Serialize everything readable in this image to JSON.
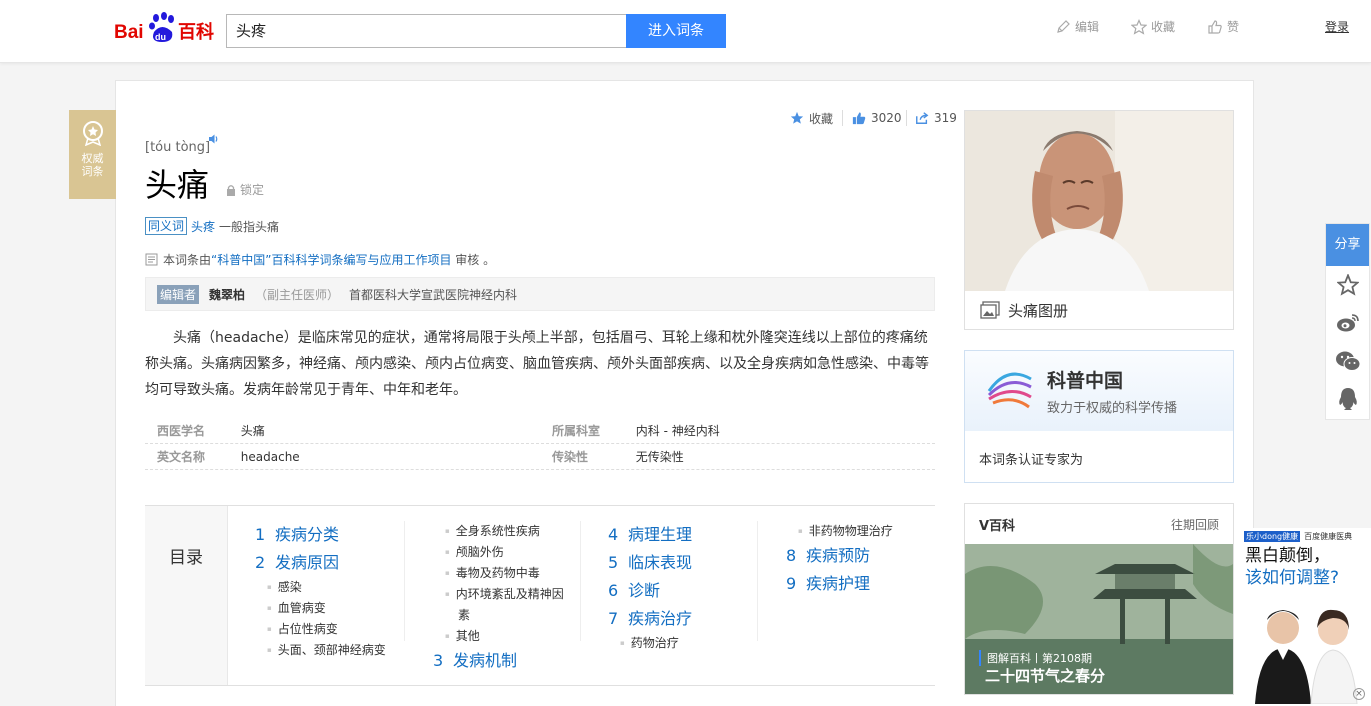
{
  "header": {
    "logo_text_left": "Bai",
    "logo_text_du": "du",
    "logo_text_right": "百科",
    "search_value": "头疼",
    "search_button": "进入词条",
    "edit_label": "编辑",
    "collect_label": "收藏",
    "like_label": "赞",
    "login_label": "登录"
  },
  "badge": {
    "line1": "权威",
    "line2": "词条"
  },
  "stats": {
    "collect_label": "收藏",
    "like_count": "3020",
    "share_count": "319"
  },
  "entry": {
    "pinyin": "[tóu tòng]",
    "title": "头痛",
    "lock_label": "锁定",
    "synonym_tag": "同义词",
    "synonym_link": "头疼",
    "synonym_text": "一般指头痛",
    "review_prefix": "本词条由",
    "review_link": "“科普中国”百科科学词条编写与应用工作项目",
    "review_suffix": "审核 。",
    "editor_tag": "编辑者",
    "editor_name": "魏翠柏",
    "editor_role": "（副主任医师）",
    "editor_hospital": "首都医科大学宣武医院神经内科",
    "summary": "头痛（headache）是临床常见的症状，通常将局限于头颅上半部，包括眉弓、耳轮上缘和枕外隆突连线以上部位的疼痛统称头痛。头痛病因繁多，神经痛、颅内感染、颅内占位病变、脑血管疾病、颅外头面部疾病、以及全身疾病如急性感染、中毒等均可导致头痛。发病年龄常见于青年、中年和老年。"
  },
  "basic_info": [
    {
      "k1": "西医学名",
      "v1": "头痛",
      "k2": "所属科室",
      "v2": "内科 - 神经内科"
    },
    {
      "k1": "英文名称",
      "v1": "headache",
      "k2": "传染性",
      "v2": "无传染性"
    }
  ],
  "catalog": {
    "title": "目录",
    "col1": [
      {
        "type": "l1",
        "num": "1",
        "text": "疾病分类"
      },
      {
        "type": "l1",
        "num": "2",
        "text": "发病原因"
      },
      {
        "type": "l2",
        "text": "感染"
      },
      {
        "type": "l2",
        "text": "血管病变"
      },
      {
        "type": "l2",
        "text": "占位性病变"
      },
      {
        "type": "l2",
        "text": "头面、颈部神经病变"
      }
    ],
    "col2": [
      {
        "type": "l2",
        "text": "全身系统性疾病"
      },
      {
        "type": "l2",
        "text": "颅脑外伤"
      },
      {
        "type": "l2",
        "text": "毒物及药物中毒"
      },
      {
        "type": "l2",
        "text": "内环境紊乱及精神因"
      },
      {
        "type": "l2c",
        "text": "素"
      },
      {
        "type": "l2",
        "text": "其他"
      },
      {
        "type": "l1",
        "num": "3",
        "text": "发病机制"
      }
    ],
    "col3": [
      {
        "type": "l1",
        "num": "4",
        "text": "病理生理"
      },
      {
        "type": "l1",
        "num": "5",
        "text": "临床表现"
      },
      {
        "type": "l1",
        "num": "6",
        "text": "诊断"
      },
      {
        "type": "l1",
        "num": "7",
        "text": "疾病治疗"
      },
      {
        "type": "l2",
        "text": "药物治疗"
      }
    ],
    "col4": [
      {
        "type": "l2",
        "text": "非药物物理治疗"
      },
      {
        "type": "l1",
        "num": "8",
        "text": "疾病预防"
      },
      {
        "type": "l1",
        "num": "9",
        "text": "疾病护理"
      }
    ]
  },
  "sidebar": {
    "album_caption": "头痛图册",
    "kepu_title": "科普中国",
    "kepu_sub": "致力于权威的科学传播",
    "kepu_expert": "本词条认证专家为",
    "v_title": "V百科",
    "v_past": "往期回顾",
    "v_sub": "图解百科丨第2108期",
    "v_main": "二十四节气之春分"
  },
  "share": {
    "label": "分享"
  },
  "ad": {
    "brand1": "乐小dong健康",
    "brand2": "百度健康医典",
    "line1": "黑白颠倒，",
    "line2": "该如何调整?"
  },
  "colors": {
    "accent": "#3385ff",
    "link": "#136ec2",
    "badge": "#d9c593"
  }
}
